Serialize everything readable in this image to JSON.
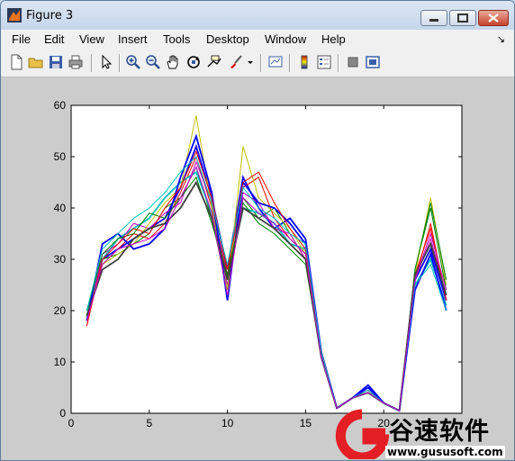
{
  "window": {
    "title": "Figure 3"
  },
  "menu": {
    "items": [
      "File",
      "Edit",
      "View",
      "Insert",
      "Tools",
      "Desktop",
      "Window",
      "Help"
    ],
    "dock_glyph": "↘"
  },
  "toolbar": {
    "icons": [
      "new-figure-icon",
      "open-file-icon",
      "save-icon",
      "print-icon",
      "edit-plot-arrow-icon",
      "zoom-in-icon",
      "zoom-out-icon",
      "pan-hand-icon",
      "rotate-3d-icon",
      "data-cursor-icon",
      "brush-icon",
      "brush-dropdown-icon",
      "link-plot-icon",
      "colorbar-icon",
      "legend-icon",
      "hide-plot-tools-icon",
      "show-plot-tools-icon"
    ]
  },
  "watermark": {
    "brand": "谷速软件",
    "url": "www.gususoft.com",
    "accent": "#e31e24"
  },
  "chart_data": {
    "type": "line",
    "title": "",
    "xlabel": "",
    "ylabel": "",
    "xlim": [
      0,
      25
    ],
    "ylim": [
      0,
      60
    ],
    "x_ticks": [
      "0",
      "5",
      "10",
      "15",
      "20"
    ],
    "y_ticks": [
      "0",
      "10",
      "20",
      "30",
      "40",
      "50",
      "60"
    ],
    "grid": false,
    "x": [
      1,
      2,
      3,
      4,
      5,
      6,
      7,
      8,
      9,
      10,
      11,
      12,
      13,
      14,
      15,
      16,
      17,
      18,
      19,
      20,
      21,
      22,
      23,
      24
    ],
    "series": [
      {
        "color": "#0000ff",
        "values": [
          18,
          30,
          32,
          34,
          36,
          38,
          44,
          52,
          42,
          28,
          46,
          40,
          36,
          38,
          34,
          12,
          1,
          3,
          5,
          2,
          0.5,
          26,
          32,
          22
        ]
      },
      {
        "color": "#008000",
        "values": [
          20,
          30,
          31,
          33,
          35,
          40,
          42,
          48,
          38,
          24,
          42,
          38,
          40,
          35,
          30,
          11,
          1,
          3,
          4,
          2,
          0.5,
          28,
          40,
          24
        ]
      },
      {
        "color": "#ff0000",
        "values": [
          18,
          29,
          32,
          35,
          34,
          37,
          43,
          50,
          40,
          27,
          44,
          46,
          38,
          34,
          31,
          12,
          1,
          3,
          4.5,
          2,
          0.5,
          27,
          36,
          22
        ]
      },
      {
        "color": "#00bfbf",
        "values": [
          19,
          30,
          34,
          36,
          38,
          42,
          45,
          47,
          39,
          26,
          40,
          39,
          37,
          33,
          32,
          11,
          1,
          3,
          4,
          2,
          0.5,
          25,
          30,
          21
        ]
      },
      {
        "color": "#bf00bf",
        "values": [
          17,
          31,
          33,
          37,
          36,
          39,
          41,
          49,
          41,
          25,
          43,
          41,
          36,
          35,
          30,
          12,
          1,
          3,
          4.5,
          2,
          0.5,
          26,
          34,
          23
        ]
      },
      {
        "color": "#bfbf00",
        "values": [
          19,
          29,
          31,
          33,
          37,
          41,
          44,
          58,
          40,
          24,
          52,
          42,
          39,
          36,
          31,
          11,
          1,
          3,
          4,
          2,
          0.5,
          27,
          42,
          25
        ]
      },
      {
        "color": "#0000ff",
        "values": [
          18,
          33,
          35,
          32,
          33,
          36,
          46,
          54,
          43,
          22,
          45,
          41,
          40,
          37,
          33,
          12,
          1,
          3,
          5.5,
          2,
          0.5,
          24,
          31,
          20
        ]
      },
      {
        "color": "#008000",
        "values": [
          20,
          31,
          34,
          35,
          39,
          38,
          42,
          46,
          37,
          27,
          41,
          37,
          35,
          32,
          29,
          11,
          1,
          3,
          4,
          2,
          0.5,
          28,
          41,
          26
        ]
      },
      {
        "color": "#ff0000",
        "values": [
          17,
          30,
          33,
          36,
          35,
          40,
          44,
          51,
          42,
          28,
          45,
          47,
          41,
          36,
          32,
          12,
          1,
          3,
          4,
          2,
          0.5,
          26,
          37,
          22
        ]
      },
      {
        "color": "#404040",
        "values": [
          19,
          28,
          30,
          34,
          36,
          37,
          40,
          45,
          38,
          26,
          40,
          38,
          36,
          33,
          30,
          11,
          1,
          3,
          4,
          2,
          0.5,
          27,
          33,
          23
        ]
      },
      {
        "color": "#00bfbf",
        "values": [
          20,
          32,
          35,
          38,
          40,
          43,
          47,
          50,
          41,
          29,
          44,
          40,
          38,
          35,
          33,
          12,
          1,
          3,
          4.5,
          2,
          0.5,
          25,
          29,
          20
        ]
      },
      {
        "color": "#bf00bf",
        "values": [
          18,
          29,
          32,
          33,
          34,
          36,
          42,
          48,
          39,
          23,
          42,
          39,
          37,
          34,
          31,
          11,
          1,
          3,
          4,
          2,
          0.5,
          26,
          35,
          24
        ]
      }
    ]
  }
}
